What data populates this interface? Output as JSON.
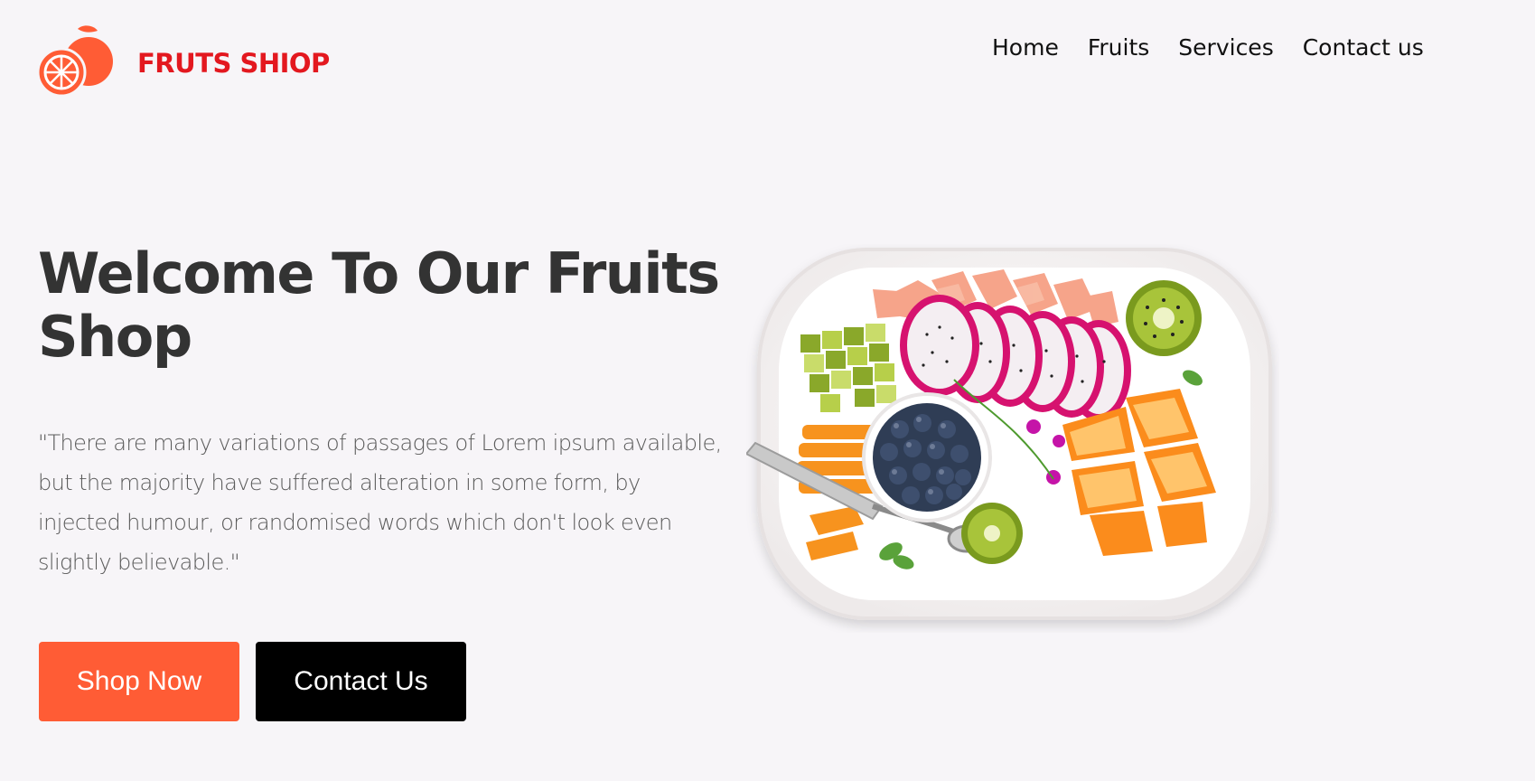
{
  "brand": {
    "name": "FRUTS SHIOP",
    "logo_icon": "orange-fruit-icon",
    "brand_color": "#e3181f",
    "logo_color": "#ff5c35"
  },
  "nav": {
    "items": [
      {
        "label": "Home"
      },
      {
        "label": "Fruits"
      },
      {
        "label": "Services"
      },
      {
        "label": "Contact us"
      }
    ]
  },
  "hero": {
    "title": "Welcome To Our Fruits Shop",
    "text": "\"There are many variations of passages of Lorem ipsum available, but the majority have suffered alteration in some form, by injected humour, or randomised words which don't look even slightly believable.\"",
    "buttons": {
      "shop_label": "Shop Now",
      "contact_label": "Contact Us"
    },
    "image_icon": "fruit-platter-image"
  },
  "colors": {
    "background": "#f7f5f8",
    "accent": "#ff5c35",
    "dark_button": "#000000",
    "title": "#333333",
    "body_text": "#5a5a5a"
  }
}
